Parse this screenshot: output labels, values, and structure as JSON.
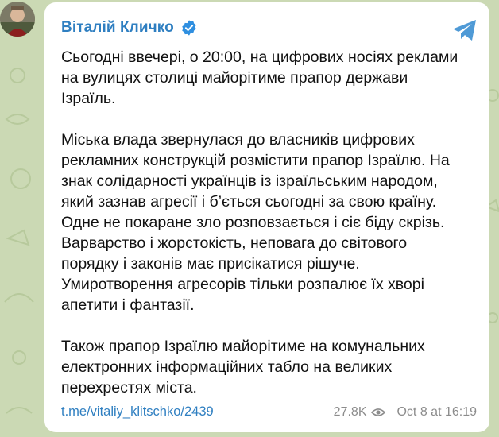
{
  "post": {
    "author": "Віталій Кличко",
    "paragraphs": [
      "Сьогодні ввечері, о 20:00, на цифрових носіях реклами\nна вулицях столиці майорітиме прапор держави\nІзраїль.",
      "Міська влада звернулася до власників цифрових\nрекламних конструкцій розмістити прапор Ізраїлю. На\nзнак солідарності українців із ізраїльським народом,\nякий зазнав агресії і б’ється сьогодні за свою країну.\nОдне не покаране зло розповзається і сіє біду скрізь.\nВарварство і жорстокість, неповага до світового\nпорядку і законів має присікатися рішуче.\nУмиротворення агресорів тільки розпалює їх хворі\nапетити і фантазії.",
      "Також прапор Ізраїлю майорітиме на комунальних\nелектронних інформаційних табло на великих\nперехрестях міста."
    ],
    "link": "t.me/vitaliy_klitschko/2439",
    "views": "27.8K",
    "date": "Oct 8 at 16:19"
  },
  "icons": {
    "verified": "verified-badge-icon",
    "share": "telegram-share-icon",
    "views": "eye-icon"
  },
  "colors": {
    "background": "#cbd9b4",
    "bubble": "#ffffff",
    "accent": "#2f7fc1",
    "meta": "#8c8c8c",
    "text": "#111111"
  }
}
